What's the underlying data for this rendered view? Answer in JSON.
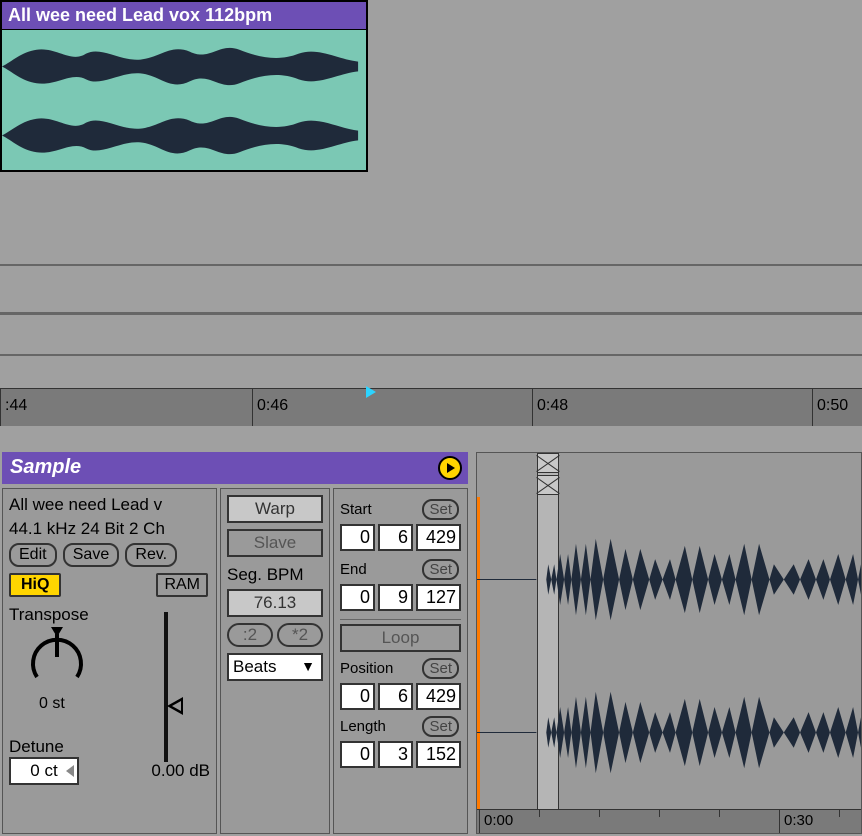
{
  "clip": {
    "title": "All wee need Lead vox 112bpm"
  },
  "ruler_top": {
    "t0": ":44",
    "t1": "0:46",
    "t2": "0:48",
    "t3": "0:50"
  },
  "sample_header": {
    "title": "Sample"
  },
  "panel1": {
    "name": "All wee need Lead v",
    "info": "44.1 kHz 24 Bit 2 Ch",
    "edit": "Edit",
    "save": "Save",
    "rev": "Rev.",
    "hiq": "HiQ",
    "ram": "RAM",
    "transpose_label": "Transpose",
    "transpose_value": "0 st",
    "detune_label": "Detune",
    "detune_value": "0 ct",
    "vol_db": "0.00 dB"
  },
  "panel2": {
    "warp": "Warp",
    "slave": "Slave",
    "seg_bpm_label": "Seg. BPM",
    "seg_bpm_value": "76.13",
    "half": ":2",
    "double": "*2",
    "mode": "Beats"
  },
  "panel3": {
    "start_label": "Start",
    "set": "Set",
    "start_b": "0",
    "start_s": "6",
    "start_t": "429",
    "end_label": "End",
    "end_b": "0",
    "end_s": "9",
    "end_t": "127",
    "loop": "Loop",
    "pos_label": "Position",
    "pos_b": "0",
    "pos_s": "6",
    "pos_t": "429",
    "len_label": "Length",
    "len_b": "0",
    "len_s": "3",
    "len_t": "152"
  },
  "ruler_bottom": {
    "t0": "0:00",
    "t1": "0:30"
  }
}
